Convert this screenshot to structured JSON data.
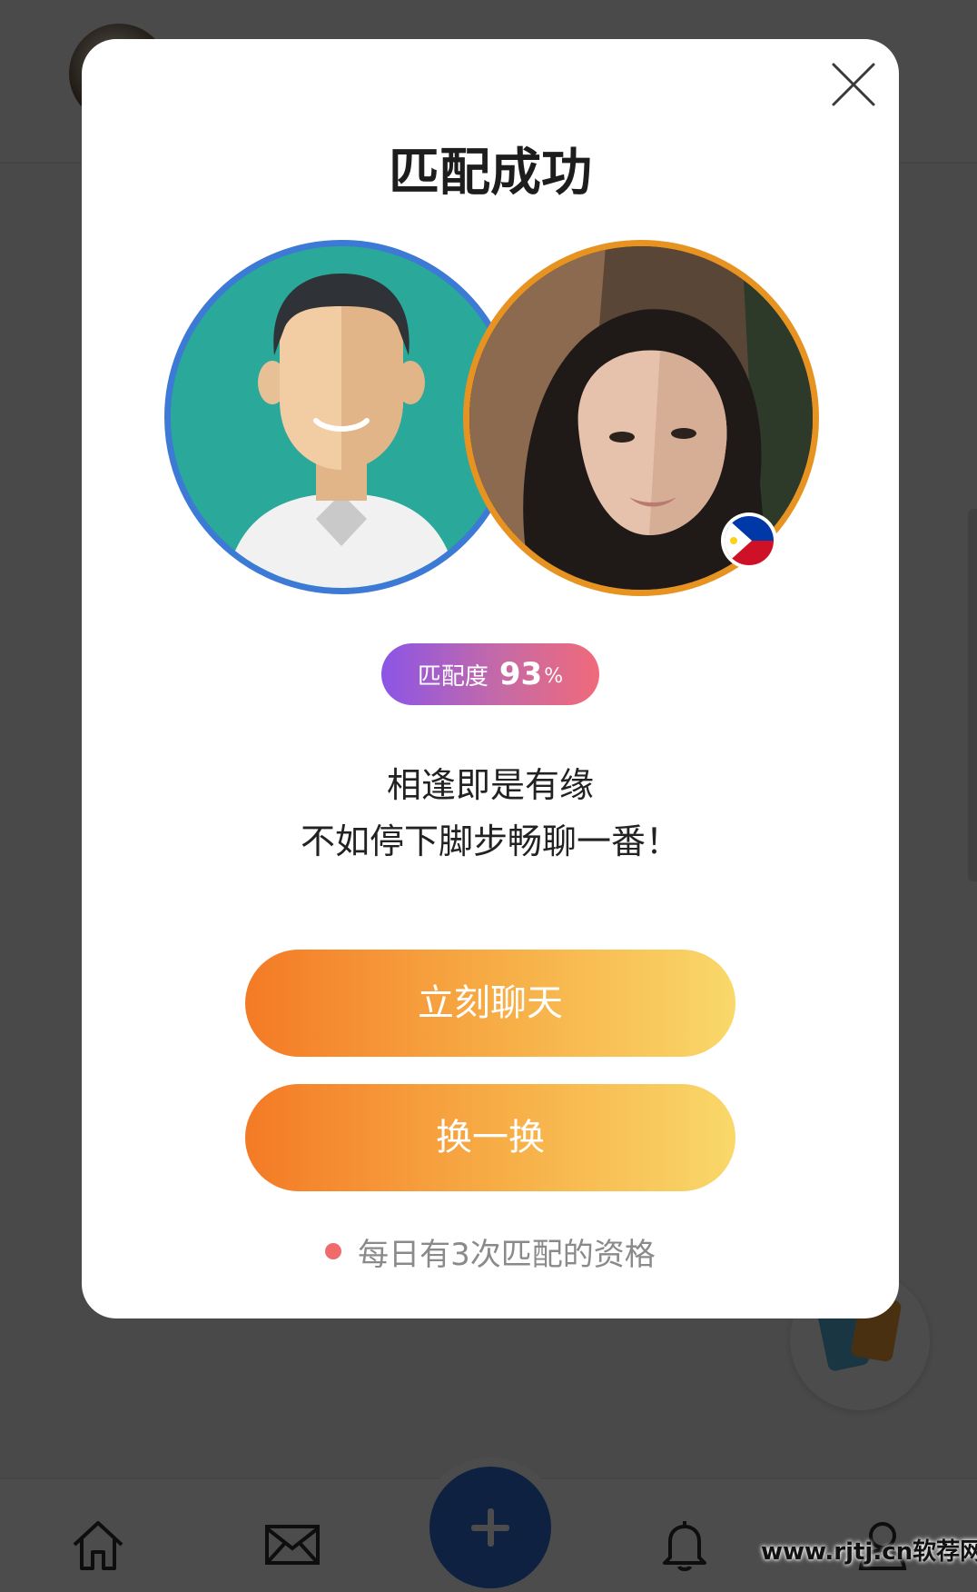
{
  "modal": {
    "title": "匹配成功",
    "match_score_label": "匹配度",
    "match_score_value": "93",
    "match_score_unit": "%",
    "message_line1": "相逢即是有缘",
    "message_line2": "不如停下脚步畅聊一番！",
    "chat_button_label": "立刻聊天",
    "swap_button_label": "换一换",
    "quota_text": "每日有3次匹配的资格",
    "close_icon": "close-icon",
    "flag_icon": "philippines-flag-icon"
  },
  "tabbar": {
    "items": [
      {
        "icon": "home-icon"
      },
      {
        "icon": "mail-icon"
      },
      {
        "icon": "plus-icon"
      },
      {
        "icon": "bell-icon"
      },
      {
        "icon": "profile-icon"
      }
    ]
  },
  "watermark": {
    "text": "www.rjtj.cn软荐网"
  },
  "colors": {
    "user_ring": "#3d7ad6",
    "match_ring": "#e69322",
    "pill_gradient_start": "#8b55e6",
    "pill_gradient_end": "#f06a7a",
    "button_gradient_start": "#f47a26",
    "button_gradient_end": "#f9d86a",
    "quota_dot": "#f06b6b"
  }
}
